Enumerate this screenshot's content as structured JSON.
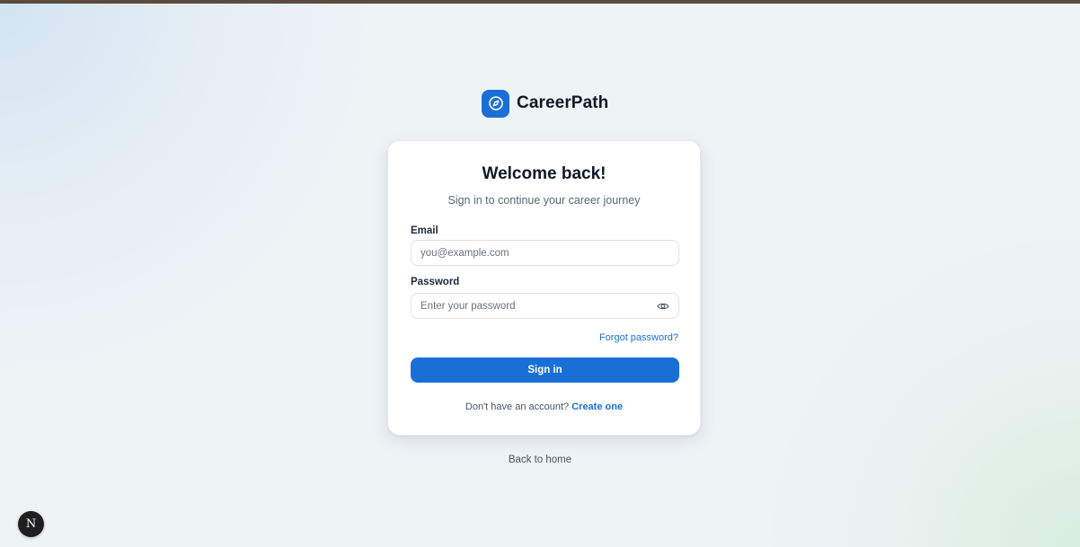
{
  "brand": {
    "name": "CareerPath",
    "icon": "compass-icon",
    "accent": "#1a6fd6"
  },
  "card": {
    "title": "Welcome back!",
    "subtitle": "Sign in to continue your career journey"
  },
  "form": {
    "email": {
      "label": "Email",
      "placeholder": "you@example.com",
      "value": ""
    },
    "password": {
      "label": "Password",
      "placeholder": "Enter your password",
      "value": "",
      "toggle_icon": "eye-icon"
    },
    "forgot_label": "Forgot password?",
    "submit_label": "Sign in"
  },
  "signup": {
    "prompt": "Don't have an account?",
    "link_label": "Create one"
  },
  "footer": {
    "back_label": "Back to home"
  },
  "dev_badge": {
    "letter": "N"
  }
}
